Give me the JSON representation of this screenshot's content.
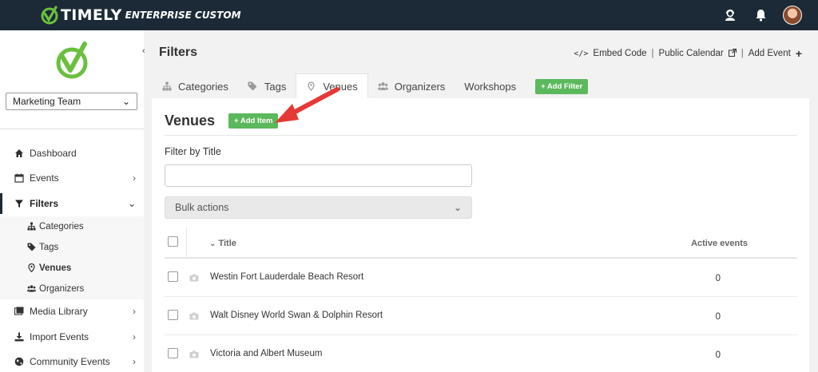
{
  "brand": {
    "name": "TIMELY",
    "edition": "ENTERPRISE CUSTOM",
    "logo_icon": "check-circle-logo",
    "accent": "#6bbf3f"
  },
  "topbar": {
    "bg": "#1b2a36",
    "icons": [
      "user-support-icon",
      "bell-icon",
      "avatar"
    ]
  },
  "sidebar": {
    "team": "Marketing Team",
    "items": [
      {
        "label": "Dashboard",
        "icon": "home-icon",
        "chevron": ""
      },
      {
        "label": "Events",
        "icon": "calendar-icon",
        "chevron": "›"
      },
      {
        "label": "Filters",
        "icon": "filter-icon",
        "chevron": "⌄"
      },
      {
        "label": "Media Library",
        "icon": "media-icon",
        "chevron": "›"
      },
      {
        "label": "Import Events",
        "icon": "download-icon",
        "chevron": "›"
      },
      {
        "label": "Community Events",
        "icon": "globe-icon",
        "chevron": "›"
      }
    ],
    "sub_items": [
      {
        "label": "Categories",
        "icon": "sitemap-icon"
      },
      {
        "label": "Tags",
        "icon": "tags-icon"
      },
      {
        "label": "Venues",
        "icon": "map-pin-icon"
      },
      {
        "label": "Organizers",
        "icon": "users-icon"
      }
    ]
  },
  "header": {
    "title": "Filters",
    "links": {
      "embed": "Embed Code",
      "public": "Public Calendar",
      "add_event": "Add Event"
    }
  },
  "tabs": [
    {
      "label": "Categories",
      "icon": "sitemap-icon"
    },
    {
      "label": "Tags",
      "icon": "tag-icon"
    },
    {
      "label": "Venues",
      "icon": "map-pin-icon"
    },
    {
      "label": "Organizers",
      "icon": "users-icon"
    },
    {
      "label": "Workshops",
      "icon": ""
    }
  ],
  "add_filter_label": "+ Add Filter",
  "panel": {
    "title": "Venues",
    "add_item_label": "+ Add Item",
    "filter_label": "Filter by Title",
    "filter_placeholder": "",
    "bulk_label": "Bulk actions",
    "columns": {
      "title": "Title",
      "active": "Active events"
    },
    "rows": [
      {
        "title": "Westin Fort Lauderdale Beach Resort",
        "count": "0"
      },
      {
        "title": "Walt Disney World Swan & Dolphin Resort",
        "count": "0"
      },
      {
        "title": "Victoria and Albert Museum",
        "count": "0"
      }
    ]
  },
  "colors": {
    "green_button": "#5cb85c",
    "annotation_arrow": "#e53935"
  }
}
